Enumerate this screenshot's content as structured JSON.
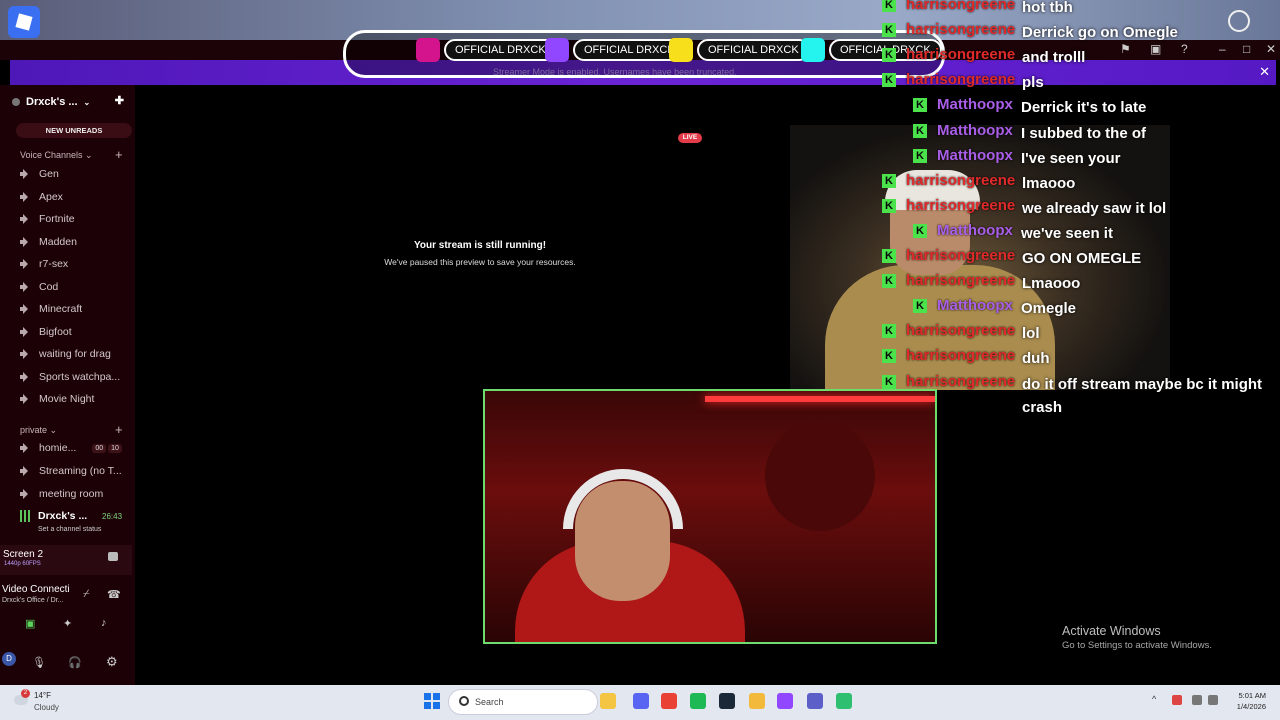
{
  "top": {
    "roblox_icon": "roblox-icon",
    "account_icon": "account-circle-icon"
  },
  "window_controls": {
    "flag": "⚑",
    "cast": "▣",
    "help": "?",
    "minimize": "–",
    "maximize": "□",
    "close": "✕"
  },
  "notice_bar": {
    "text": "Streamer Mode is enabled. Usernames have been truncated.",
    "close": "✕"
  },
  "overlay_socials": [
    {
      "icon": "instagram-icon",
      "color": "#d4148c",
      "label": "OFFICIAL DRXCK"
    },
    {
      "icon": "twitch-icon",
      "color": "#9146ff",
      "label": "OFFICIAL DRXCK"
    },
    {
      "icon": "snapchat-icon",
      "color": "#f7e01b",
      "label": "OFFICIAL DRXCK"
    },
    {
      "icon": "tiktok-icon",
      "color": "#25f4ee",
      "label": "OFFICIAL DRXCK"
    }
  ],
  "sidebar": {
    "server_name": "Drxck's ...",
    "new_unreads": "NEW UNREADS",
    "voice_category": "Voice Channels",
    "voice_channels": [
      "Gen",
      "Apex",
      "Fortnite",
      "Madden",
      "r7-sex",
      "Cod",
      "Minecraft",
      "Bigfoot",
      "waiting for drag",
      "Sports watchpa...",
      "Movie Night"
    ],
    "private_category": "private",
    "private_channels": [
      {
        "name": "homie...",
        "badge1": "00",
        "badge2": "10"
      },
      {
        "name": "Streaming (no T..."
      },
      {
        "name": "meeting room"
      }
    ],
    "active_channel": {
      "name": "Drxck's ...",
      "time": "26:43",
      "status": "Set a channel status"
    },
    "screen_share": {
      "title": "Screen 2",
      "quality": "1440p 60FPS"
    },
    "video_connection": {
      "title": "Video Connecti",
      "subtitle": "Drxck's Office / Dr..."
    },
    "user_initial": "D"
  },
  "stream": {
    "live": "LIVE",
    "heading": "Your stream is still running!",
    "sub": "We've paused this preview to save your resources."
  },
  "chat": [
    {
      "user": "harrisongreene",
      "color": "#e02a2a",
      "msg": "hot tbh",
      "indent": 0
    },
    {
      "user": "harrisongreene",
      "color": "#e02a2a",
      "msg": "Derrick go on Omegle",
      "indent": 0
    },
    {
      "user": "harrisongreene",
      "color": "#e02a2a",
      "msg": "and trolll",
      "indent": 0
    },
    {
      "user": "harrisongreene",
      "color": "#e02a2a",
      "msg": "pls",
      "indent": 0
    },
    {
      "user": "Matthoopx",
      "color": "#a95ee8",
      "msg": "Derrick it's to late",
      "indent": 1
    },
    {
      "user": "Matthoopx",
      "color": "#a95ee8",
      "msg": "I subbed to the of",
      "indent": 1
    },
    {
      "user": "Matthoopx",
      "color": "#a95ee8",
      "msg": "I've seen your",
      "indent": 1
    },
    {
      "user": "harrisongreene",
      "color": "#e02a2a",
      "msg": "lmaooo",
      "indent": 0
    },
    {
      "user": "harrisongreene",
      "color": "#e02a2a",
      "msg": "we already saw it lol",
      "indent": 0
    },
    {
      "user": "Matthoopx",
      "color": "#a95ee8",
      "msg": "we've seen it",
      "indent": 1
    },
    {
      "user": "harrisongreene",
      "color": "#e02a2a",
      "msg": "GO ON OMEGLE",
      "indent": 0
    },
    {
      "user": "harrisongreene",
      "color": "#e02a2a",
      "msg": "Lmaooo",
      "indent": 0
    },
    {
      "user": "Matthoopx",
      "color": "#a95ee8",
      "msg": "Omegle",
      "indent": 1
    },
    {
      "user": "harrisongreene",
      "color": "#e02a2a",
      "msg": "lol",
      "indent": 0
    },
    {
      "user": "harrisongreene",
      "color": "#e02a2a",
      "msg": "duh",
      "indent": 0
    },
    {
      "user": "harrisongreene",
      "color": "#e02a2a",
      "msg": "do it off stream maybe bc it might crash",
      "indent": 0
    }
  ],
  "chat_badge_letter": "K",
  "watermark": {
    "title": "Activate Windows",
    "sub": "Go to Settings to activate Windows."
  },
  "taskbar": {
    "weather_temp": "14°F",
    "weather_cond": "Cloudy",
    "weather_badge": "2",
    "search_label": "Search",
    "apps": [
      {
        "icon": "file-explorer-icon",
        "color": "#f4c542"
      },
      {
        "icon": "discord-icon",
        "color": "#5865f2"
      },
      {
        "icon": "chrome-icon",
        "color": "#e94235"
      },
      {
        "icon": "spotify-icon",
        "color": "#1db954"
      },
      {
        "icon": "steam-icon",
        "color": "#1b2838"
      },
      {
        "icon": "folder-icon",
        "color": "#f2b93b"
      },
      {
        "icon": "twitch-icon",
        "color": "#9146ff"
      },
      {
        "icon": "teams-icon",
        "color": "#5b5fc7"
      },
      {
        "icon": "app-icon",
        "color": "#2fbf71"
      }
    ],
    "tray_up": "^",
    "time": "5:01 AM",
    "date": "1/4/2026"
  }
}
